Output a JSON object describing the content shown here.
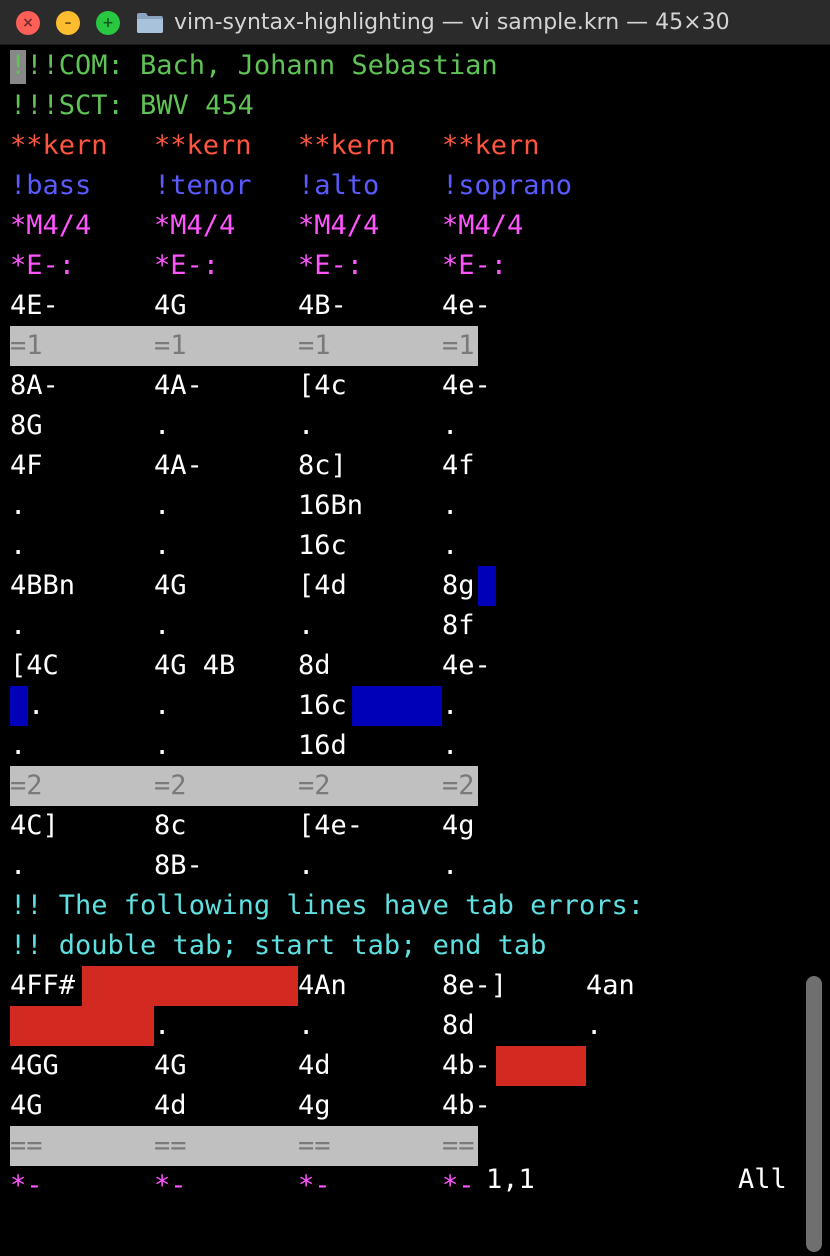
{
  "window": {
    "title": "vim-syntax-highlighting — vi sample.krn — 45×30",
    "close_glyph": "×",
    "minimize_glyph": "–",
    "zoom_glyph": "+"
  },
  "colors": {
    "com": "#5fc356",
    "kern": "#ff5540",
    "comment": "#5a5aff",
    "interp": "#ff55ff",
    "gloss": "#5fe0e0",
    "tab_highlight": "#0000b8",
    "error_highlight": "#d22a20",
    "barline_background": "#c0c0c0"
  },
  "editor": {
    "lines": [
      {
        "type": "com",
        "text": "!!!COM: Bach, Johann Sebastian"
      },
      {
        "type": "com",
        "text": "!!!SCT: BWV 454"
      },
      {
        "type": "kern",
        "cols": [
          "**kern",
          "**kern",
          "**kern",
          "**kern"
        ]
      },
      {
        "type": "comment",
        "cols": [
          "!bass",
          "!tenor",
          "!alto",
          "!soprano"
        ]
      },
      {
        "type": "interp",
        "cols": [
          "*M4/4",
          "*M4/4",
          "*M4/4",
          "*M4/4"
        ]
      },
      {
        "type": "interp",
        "cols": [
          "*E-:",
          "*E-:",
          "*E-:",
          "*E-:"
        ]
      },
      {
        "type": "data",
        "cols": [
          "4E-",
          "4G",
          "4B-",
          "4e-"
        ]
      },
      {
        "type": "barline",
        "cols": [
          "=1",
          "=1",
          "=1",
          "=1"
        ]
      },
      {
        "type": "data",
        "cols": [
          "8A-",
          "4A-",
          "[4c",
          "4e-"
        ]
      },
      {
        "type": "data",
        "cols": [
          "8G",
          ".",
          ".",
          "."
        ]
      },
      {
        "type": "data",
        "cols": [
          "4F",
          "4A-",
          "8c]",
          "4f"
        ]
      },
      {
        "type": "data",
        "cols": [
          ".",
          ".",
          "16Bn",
          "."
        ]
      },
      {
        "type": "data",
        "cols": [
          ".",
          ".",
          "16c",
          "."
        ]
      },
      {
        "type": "data",
        "cols": [
          "4BBn",
          "4G",
          "[4d",
          "8g"
        ]
      },
      {
        "type": "data",
        "cols": [
          ".",
          ".",
          ".",
          "8f"
        ]
      },
      {
        "type": "data",
        "cols": [
          "[4C",
          "4G 4B",
          "8d",
          "4e-"
        ]
      },
      {
        "type": "data",
        "cols": [
          ".",
          ".",
          "16c",
          "."
        ]
      },
      {
        "type": "data",
        "cols": [
          ".",
          ".",
          "16d",
          "."
        ]
      },
      {
        "type": "barline",
        "cols": [
          "=2",
          "=2",
          "=2",
          "=2"
        ]
      },
      {
        "type": "data",
        "cols": [
          "4C]",
          "8c",
          "[4e-",
          "4g"
        ]
      },
      {
        "type": "data",
        "cols": [
          ".",
          "8B-",
          ".",
          "."
        ]
      },
      {
        "type": "gloss",
        "text": "!! The following lines have tab errors:"
      },
      {
        "type": "gloss",
        "text": "!! double tab; start tab; end tab"
      },
      {
        "type": "data",
        "cols": [
          "4FF#",
          "4An",
          "8e-]",
          "4an"
        ]
      },
      {
        "type": "data",
        "cols": [
          ".",
          ".",
          "8d",
          "."
        ]
      },
      {
        "type": "data",
        "cols": [
          "4GG",
          "4G",
          "4d",
          "4b-"
        ]
      },
      {
        "type": "data",
        "cols": [
          "4G",
          "4d",
          "4g",
          "4b-"
        ]
      },
      {
        "type": "barline",
        "cols": [
          "==",
          "==",
          "==",
          "=="
        ]
      },
      {
        "type": "interp",
        "cols": [
          "*-",
          "*-",
          "*-",
          "*-"
        ]
      }
    ]
  },
  "status": {
    "position": "1,1",
    "scroll": "All"
  }
}
